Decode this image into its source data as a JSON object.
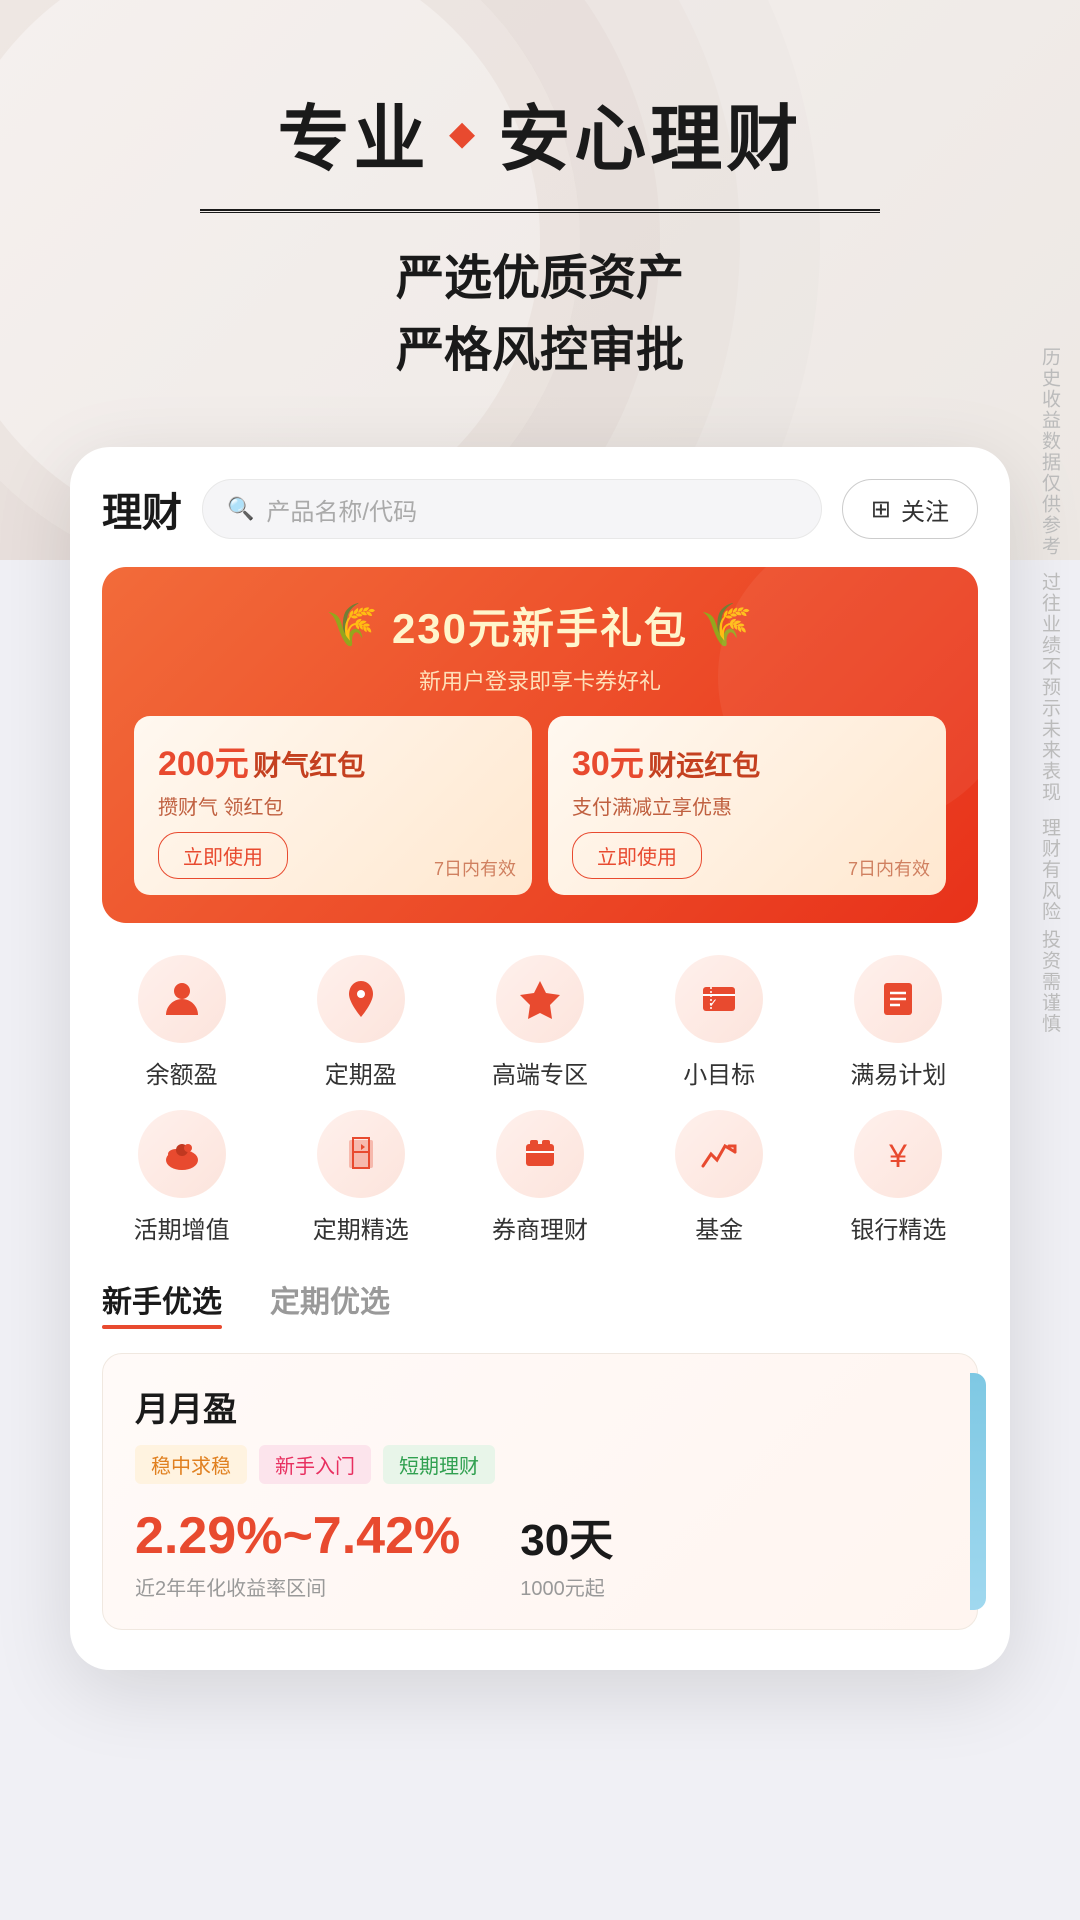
{
  "hero": {
    "title_left": "专业",
    "title_right": "安心理财",
    "diamond": "◆",
    "subtitle_line1": "严选优质资产",
    "subtitle_line2": "严格风控审批"
  },
  "header": {
    "title": "理财",
    "search_placeholder": "产品名称/代码",
    "follow_label": "关注",
    "follow_icon": "⊞"
  },
  "banner": {
    "title": "230元新手礼包",
    "subtitle": "新用户登录即享卡券好礼",
    "leaf_left": "🌾",
    "leaf_right": "🌾",
    "card1": {
      "amount": "200元",
      "name": "财气红包",
      "desc": "攒财气 领红包",
      "btn_label": "立即使用",
      "expire": "7日内有效"
    },
    "card2": {
      "amount": "30元",
      "name": "财运红包",
      "desc": "支付满减立享优惠",
      "btn_label": "立即使用",
      "expire": "7日内有效"
    }
  },
  "icon_grid": [
    {
      "label": "余额盈",
      "icon": "👤",
      "color": "#e84a2f"
    },
    {
      "label": "定期盈",
      "icon": "📍",
      "color": "#e84a2f"
    },
    {
      "label": "高端专区",
      "icon": "💎",
      "color": "#e84a2f"
    },
    {
      "label": "小目标",
      "icon": "🎯",
      "color": "#e84a2f"
    },
    {
      "label": "满易计划",
      "icon": "📋",
      "color": "#e84a2f"
    },
    {
      "label": "活期增值",
      "icon": "🐷",
      "color": "#e84a2f"
    },
    {
      "label": "定期精选",
      "icon": "⏳",
      "color": "#e84a2f"
    },
    {
      "label": "券商理财",
      "icon": "💼",
      "color": "#e84a2f"
    },
    {
      "label": "基金",
      "icon": "📈",
      "color": "#e84a2f"
    },
    {
      "label": "银行精选",
      "icon": "🏦",
      "color": "#e84a2f"
    }
  ],
  "tabs": [
    {
      "label": "新手优选",
      "active": true
    },
    {
      "label": "定期优选",
      "active": false
    }
  ],
  "product": {
    "name": "月月盈",
    "tags": [
      {
        "label": "稳中求稳",
        "type": "stable"
      },
      {
        "label": "新手入门",
        "type": "newbie"
      },
      {
        "label": "短期理财",
        "type": "short"
      }
    ],
    "rate": "2.29%~7.42%",
    "rate_label": "近2年年化收益率区间",
    "days": "30天",
    "min_amount": "1000元起"
  },
  "side_disclaimer": "历史收益数据仅供参考\n\n过往业绩不预示未来表现\n\n理财有风险 投资需谨慎"
}
